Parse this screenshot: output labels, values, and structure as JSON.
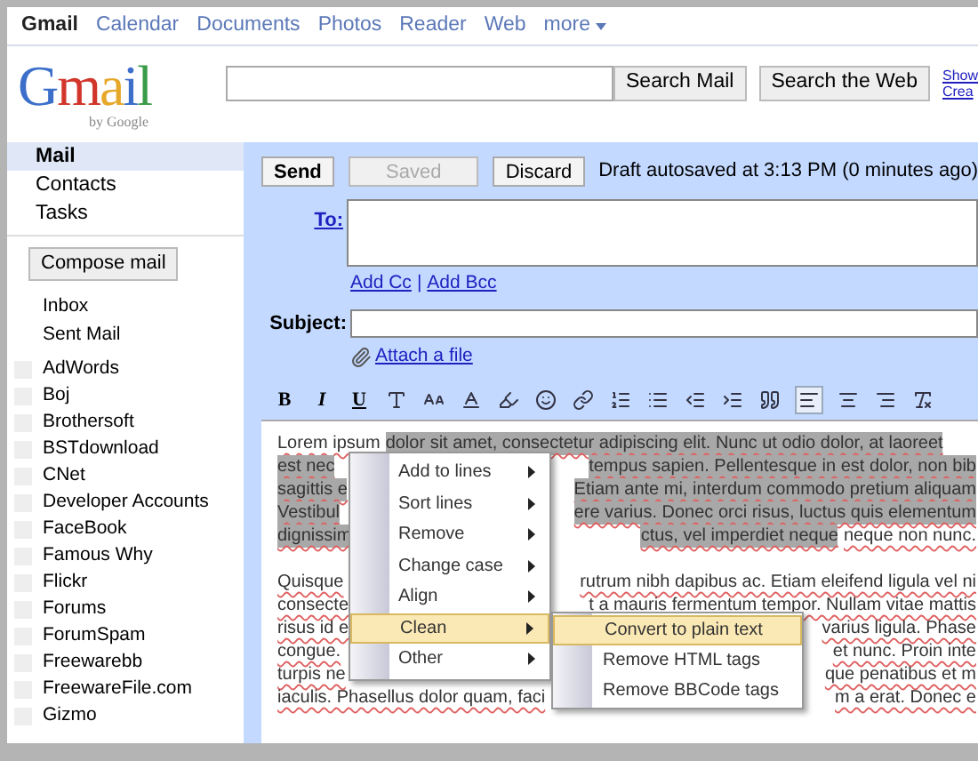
{
  "top_nav": [
    {
      "label": "Gmail",
      "selected": true
    },
    {
      "label": "Calendar",
      "selected": false
    },
    {
      "label": "Documents",
      "selected": false
    },
    {
      "label": "Photos",
      "selected": false
    },
    {
      "label": "Reader",
      "selected": false
    },
    {
      "label": "Web",
      "selected": false
    },
    {
      "label": "more",
      "selected": false
    }
  ],
  "logo": {
    "name": "Gmail",
    "byline": "by Google"
  },
  "search": {
    "buttons": [
      "Search Mail",
      "Search the Web"
    ],
    "links": [
      "Show",
      "Crea"
    ]
  },
  "sidebar": {
    "nav": [
      {
        "label": "Mail",
        "selected": true
      },
      {
        "label": "Contacts",
        "selected": false
      },
      {
        "label": "Tasks",
        "selected": false
      }
    ],
    "compose_button": "Compose mail",
    "folders": [
      "Inbox",
      "Sent Mail"
    ],
    "labels": [
      "AdWords",
      "Boj",
      "Brothersoft",
      "BSTdownload",
      "CNet",
      "Developer Accounts",
      "FaceBook",
      "Famous Why",
      "Flickr",
      "Forums",
      "ForumSpam",
      "Freewarebb",
      "FreewareFile.com",
      "Gizmo"
    ]
  },
  "compose": {
    "send": "Send",
    "saved": {
      "label": "Saved",
      "disabled": true
    },
    "discard": "Discard",
    "status": "Draft autosaved at 3:13 PM (0 minutes ago)",
    "to_label": "To:",
    "add_cc": "Add Cc",
    "separator": "|",
    "add_bcc": "Add Bcc",
    "subject_label": "Subject:",
    "attach": "Attach a file",
    "toolbar": [
      {
        "kind": "text",
        "label": "B",
        "selected": false
      },
      {
        "kind": "text",
        "label": "I",
        "selected": false
      },
      {
        "kind": "text",
        "label": "U",
        "selected": false
      },
      {
        "kind": "icon",
        "selected": false
      },
      {
        "kind": "icon",
        "selected": false
      },
      {
        "kind": "icon",
        "selected": false
      },
      {
        "kind": "icon",
        "selected": false
      },
      {
        "kind": "icon",
        "selected": false
      },
      {
        "kind": "icon",
        "selected": false
      },
      {
        "kind": "icon",
        "selected": false
      },
      {
        "kind": "icon",
        "selected": false
      },
      {
        "kind": "icon",
        "selected": false
      },
      {
        "kind": "icon",
        "selected": false
      },
      {
        "kind": "icon",
        "selected": false
      },
      {
        "kind": "icon",
        "selected": true
      },
      {
        "kind": "icon",
        "selected": false
      },
      {
        "kind": "icon",
        "selected": false
      },
      {
        "kind": "icon",
        "selected": false
      }
    ],
    "paragraphs": [
      [
        {
          "left": [
            {
              "text": "Lorem ipsum",
              "selected": false
            },
            {
              "text": "dolor sit amet, consectetur adipiscing elit. Nunc ut odio dolor, at laoreet",
              "selected": true
            }
          ]
        },
        {
          "left": [
            {
              "text": "est nec",
              "selected": true
            }
          ],
          "right": [
            {
              "text": "tempus sapien. Pellentesque in est dolor, non bib",
              "selected": true
            }
          ]
        },
        {
          "left": [
            {
              "text": "sagittis e",
              "selected": true
            }
          ],
          "right": [
            {
              "text": "Etiam ante mi, interdum commodo pretium aliquam",
              "selected": true
            }
          ]
        },
        {
          "left": [
            {
              "text": "Vestibul",
              "selected": true
            }
          ],
          "right": [
            {
              "text": "ere varius. Donec orci risus, luctus quis elementum",
              "selected": true
            }
          ]
        },
        {
          "left": [
            {
              "text": "dignissim",
              "selected": true
            }
          ],
          "right": [
            {
              "text": "ctus, vel imperdiet neque",
              "selected": true
            },
            {
              "text": "neque non nunc.",
              "selected": false
            }
          ]
        }
      ],
      [
        {
          "left": [
            {
              "text": "Quisque",
              "selected": false
            }
          ],
          "right": [
            {
              "text": "rutrum nibh dapibus ac. Etiam eleifend ligula vel ni",
              "selected": false
            }
          ]
        },
        {
          "left": [
            {
              "text": "consecte",
              "selected": false
            }
          ],
          "right": [
            {
              "text": "t a mauris fermentum tempor. Nullam vitae mattis",
              "selected": false
            }
          ]
        },
        {
          "left": [
            {
              "text": "risus id e",
              "selected": false
            }
          ],
          "right": [
            {
              "text": "varius ligula. Phase",
              "selected": false
            }
          ]
        },
        {
          "left": [
            {
              "text": "congue.",
              "selected": false
            }
          ],
          "right": [
            {
              "text": "et nunc. Proin inte",
              "selected": false
            }
          ]
        },
        {
          "left": [
            {
              "text": "turpis ne",
              "selected": false
            }
          ],
          "right": [
            {
              "text": "que penatibus et m",
              "selected": false
            }
          ]
        },
        {
          "left": [
            {
              "text": "iaculis. Phasellus dolor quam, faci",
              "selected": false
            }
          ],
          "right": [
            {
              "text": "m a erat. Donec e",
              "selected": false
            }
          ]
        }
      ]
    ]
  },
  "context_menu": {
    "items": [
      {
        "label": "Add to lines",
        "selected": false
      },
      {
        "label": "Sort lines",
        "selected": false
      },
      {
        "label": "Remove",
        "selected": false
      },
      {
        "label": "Change case",
        "selected": false
      },
      {
        "label": "Align",
        "selected": false
      },
      {
        "label": "Clean",
        "selected": true
      },
      {
        "label": "Other",
        "selected": false
      }
    ],
    "submenu": [
      {
        "label": "Convert to plain text",
        "selected": true
      },
      {
        "label": "Remove HTML tags",
        "selected": false
      },
      {
        "label": "Remove BBCode tags",
        "selected": false
      }
    ]
  }
}
